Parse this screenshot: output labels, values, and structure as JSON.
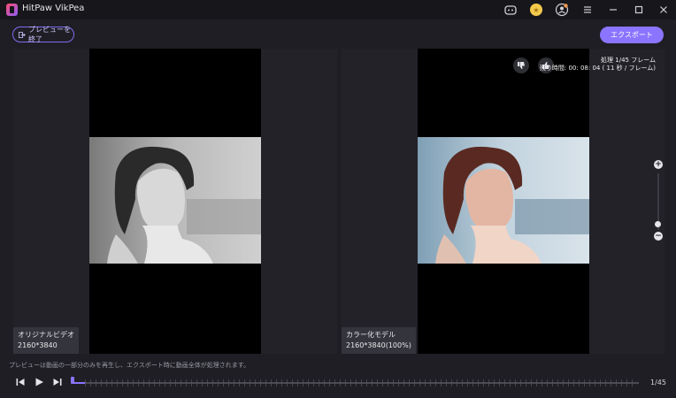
{
  "app": {
    "title": "HitPaw VikPea"
  },
  "toolbar": {
    "exit_preview_label": "プレビューを終了",
    "export_label": "エクスポート"
  },
  "left_panel": {
    "label": "オリジナルビデオ",
    "resolution": "2160*3840"
  },
  "right_panel": {
    "label": "カラー化モデル",
    "resolution": "2160*3840(100%)",
    "progress_text": "処理 1/45 フレーム",
    "remaining_text": "残り時間: 00: 08: 04 ( 11 秒 / フレーム)"
  },
  "bottom": {
    "hint": "プレビューは動画の一部分のみを再生し、エクスポート時に動画全体が処理されます。",
    "frame_counter": "1/45",
    "progress_fraction": 0.022
  },
  "icons": {
    "discord": "discord-icon",
    "coin": "coin-icon",
    "account": "account-icon",
    "menu": "menu-icon",
    "minimize": "minimize-icon",
    "maximize": "maximize-icon",
    "close": "close-icon",
    "thumbs_down": "thumbs-down-icon",
    "thumbs_up": "thumbs-up-icon",
    "zoom_in": "zoom-in-icon",
    "zoom_out": "zoom-out-icon"
  },
  "colors": {
    "accent": "#8b74ff",
    "background": "#1e1e24",
    "panel": "#222228"
  }
}
